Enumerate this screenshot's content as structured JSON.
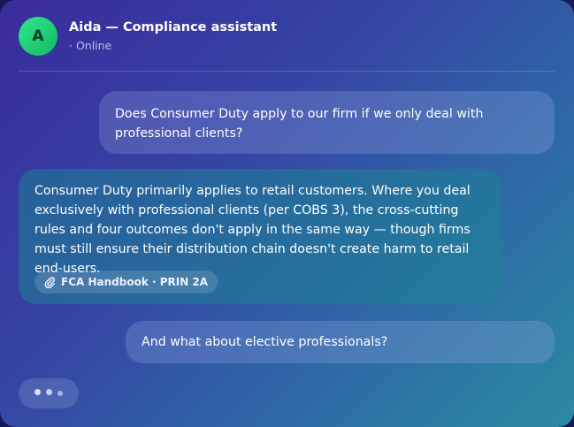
{
  "header": {
    "avatar_initial": "A",
    "title": "Aida — Compliance assistant",
    "status": "· Online"
  },
  "messages": [
    {
      "role": "user",
      "text": "Does Consumer Duty apply to our firm if we only deal with professional clients?"
    },
    {
      "role": "assistant",
      "text": "Consumer Duty primarily applies to retail customers. Where you deal exclusively with professional clients (per COBS 3), the cross-cutting rules and four outcomes don't apply in the same way — though firms must still ensure their distribution chain doesn't create harm to retail end-users.",
      "citation": {
        "icon": "paperclip-icon",
        "label": "FCA Handbook · PRIN 2A"
      }
    },
    {
      "role": "user",
      "text": "And what about elective professionals?"
    }
  ],
  "typing_indicator": {
    "visible": true
  },
  "colors": {
    "avatar": "#1fd178",
    "gradient_start": "#3a2c9c",
    "gradient_end": "#2a8aa2"
  }
}
